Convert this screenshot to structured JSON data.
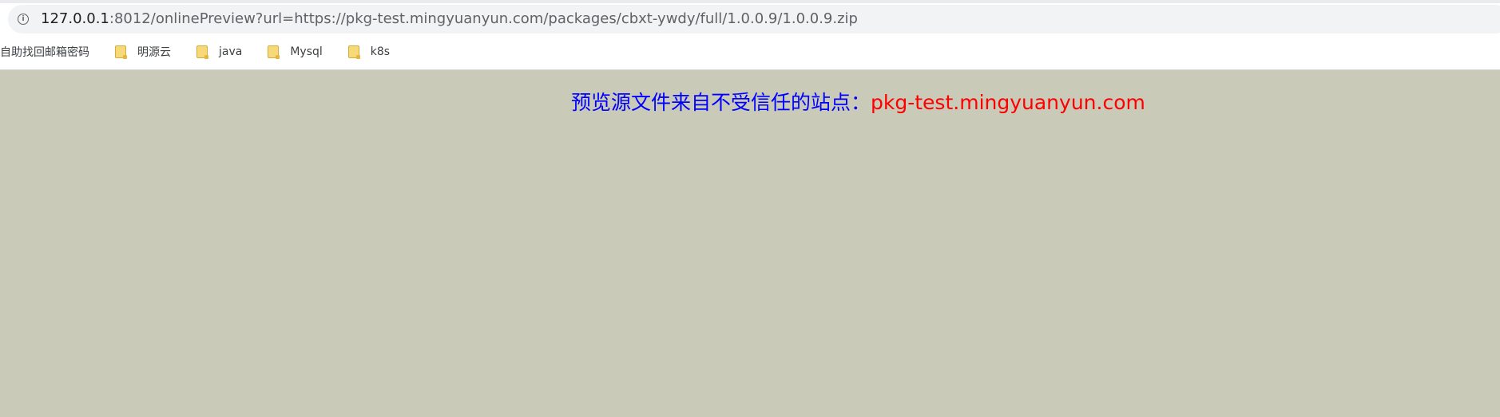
{
  "browser": {
    "address_bar": {
      "host": "127.0.0.1",
      "path": ":8012/onlinePreview?url=https://pkg-test.mingyuanyun.com/packages/cbxt-ywdy/full/1.0.0.9/1.0.0.9.zip",
      "icon": "info-icon"
    },
    "bookmarks": [
      {
        "label": "自助找回邮箱密码"
      },
      {
        "label": "明源云",
        "icon": "folder-icon"
      },
      {
        "label": "java",
        "icon": "folder-icon"
      },
      {
        "label": "Mysql",
        "icon": "folder-icon"
      },
      {
        "label": "k8s",
        "icon": "folder-icon"
      }
    ]
  },
  "page": {
    "warning_text": "预览源文件来自不受信任的站点：",
    "untrusted_host": "pkg-test.mingyuanyun.com",
    "colors": {
      "background": "#c9cab8",
      "warning_text": "#0000ff",
      "untrusted_host": "#ff0000"
    }
  }
}
